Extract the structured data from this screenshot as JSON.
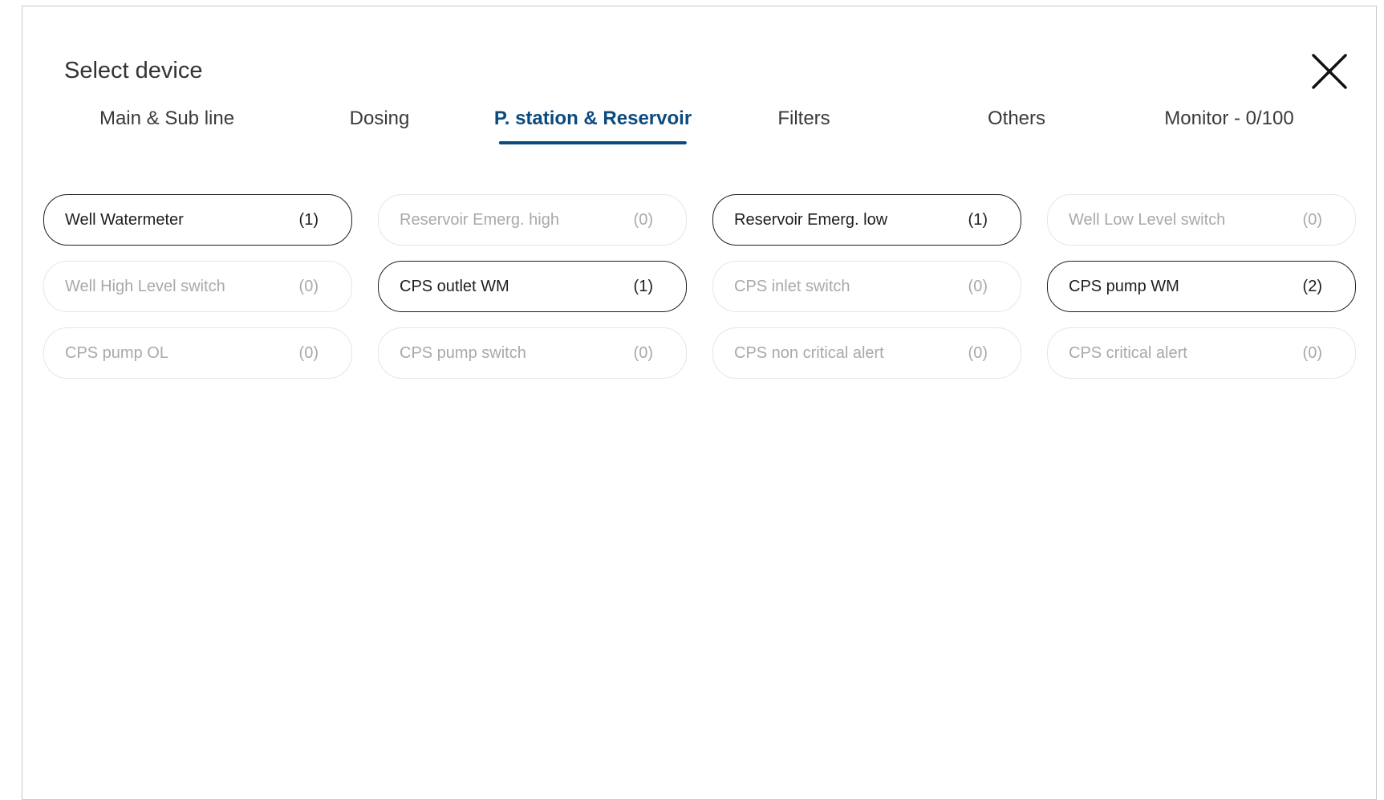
{
  "dialog": {
    "title": "Select device",
    "close_icon": "close-icon"
  },
  "tabs": [
    {
      "label": "Main & Sub line",
      "active": false
    },
    {
      "label": "Dosing",
      "active": false
    },
    {
      "label": "P. station & Reservoir",
      "active": true
    },
    {
      "label": "Filters",
      "active": false
    },
    {
      "label": "Others",
      "active": false
    },
    {
      "label": "Monitor - 0/100",
      "active": false
    }
  ],
  "devices": [
    {
      "label": "Well Watermeter",
      "count": "(1)",
      "enabled": true
    },
    {
      "label": "Reservoir Emerg. high",
      "count": "(0)",
      "enabled": false
    },
    {
      "label": "Reservoir Emerg. low",
      "count": "(1)",
      "enabled": true
    },
    {
      "label": "Well Low Level switch",
      "count": "(0)",
      "enabled": false
    },
    {
      "label": "Well High Level switch",
      "count": "(0)",
      "enabled": false
    },
    {
      "label": "CPS outlet WM",
      "count": "(1)",
      "enabled": true
    },
    {
      "label": "CPS inlet switch",
      "count": "(0)",
      "enabled": false
    },
    {
      "label": "CPS pump WM",
      "count": "(2)",
      "enabled": true
    },
    {
      "label": "CPS pump OL",
      "count": "(0)",
      "enabled": false
    },
    {
      "label": "CPS pump switch",
      "count": "(0)",
      "enabled": false
    },
    {
      "label": "CPS non critical alert",
      "count": "(0)",
      "enabled": false
    },
    {
      "label": "CPS critical alert",
      "count": "(0)",
      "enabled": false
    }
  ],
  "colors": {
    "accent": "#0b4a7e",
    "enabled_border": "#1e1e1e",
    "disabled_border": "#e6e6e6",
    "disabled_text": "#a9a9a9"
  }
}
